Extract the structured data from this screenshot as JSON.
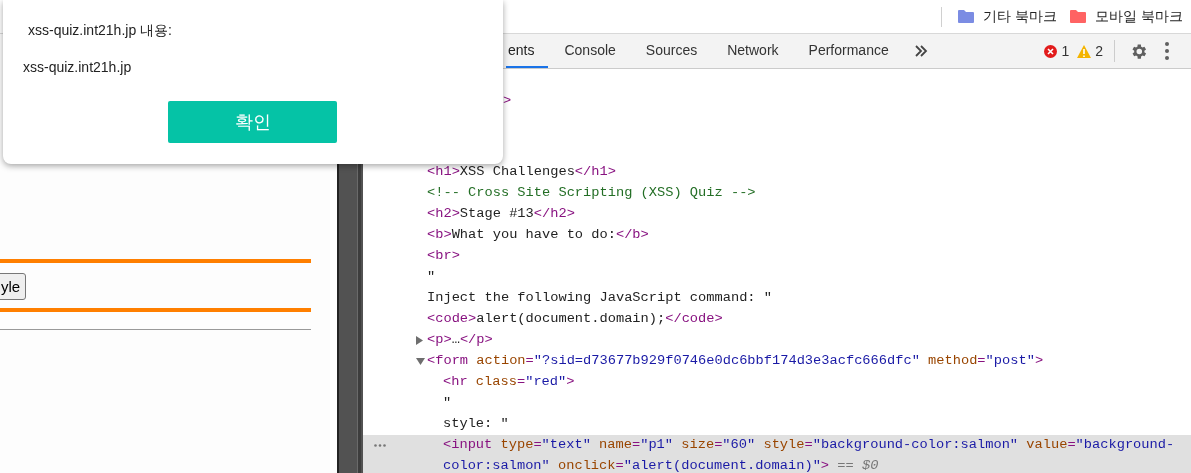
{
  "bookmarks": [
    {
      "label": "기타 북마크",
      "color": "#7b8ce3"
    },
    {
      "label": "모바일 북마크",
      "color": "#ff6363"
    }
  ],
  "page": {
    "button": "yle"
  },
  "dialog": {
    "title": "xss-quiz.int21h.jp 내용:",
    "message": "xss-quiz.int21h.jp",
    "ok": "확인"
  },
  "devtools": {
    "tabs": [
      {
        "label": "ents",
        "selected": true
      },
      {
        "label": "Console",
        "selected": false
      },
      {
        "label": "Sources",
        "selected": false
      },
      {
        "label": "Network",
        "selected": false
      },
      {
        "label": "Performance",
        "selected": false
      }
    ],
    "errors": "1",
    "warnings": "2",
    "elements": [
      {
        "kind": "clipped",
        "selected": false,
        "tokens": [
          {
            "kind": "tag",
            "text": ">"
          }
        ]
      },
      {
        "kind": "node",
        "selected": false,
        "tokens": [
          {
            "kind": "tag",
            "text": "<h1>"
          },
          {
            "kind": "text",
            "text": "XSS Challenges"
          },
          {
            "kind": "tag",
            "text": "</h1>"
          }
        ]
      },
      {
        "kind": "node",
        "selected": false,
        "tokens": [
          {
            "kind": "comment",
            "text": "<!-- Cross Site Scripting (XSS) Quiz -->"
          }
        ]
      },
      {
        "kind": "node",
        "selected": false,
        "tokens": [
          {
            "kind": "tag",
            "text": "<h2>"
          },
          {
            "kind": "text",
            "text": "Stage #13"
          },
          {
            "kind": "tag",
            "text": "</h2>"
          }
        ]
      },
      {
        "kind": "node",
        "selected": false,
        "tokens": [
          {
            "kind": "tag",
            "text": "<b>"
          },
          {
            "kind": "text",
            "text": "What you have to do:"
          },
          {
            "kind": "tag",
            "text": "</b>"
          }
        ]
      },
      {
        "kind": "node",
        "selected": false,
        "tokens": [
          {
            "kind": "tag",
            "text": "<br>"
          }
        ]
      },
      {
        "kind": "node",
        "selected": false,
        "tokens": [
          {
            "kind": "text",
            "text": "\""
          }
        ]
      },
      {
        "kind": "node",
        "selected": false,
        "tokens": [
          {
            "kind": "text",
            "text": "Inject the following JavaScript command: \""
          }
        ]
      },
      {
        "kind": "node",
        "selected": false,
        "tokens": [
          {
            "kind": "tag",
            "text": "<code>"
          },
          {
            "kind": "text",
            "text": "alert(document.domain);"
          },
          {
            "kind": "tag",
            "text": "</code>"
          }
        ]
      },
      {
        "kind": "node",
        "selected": false,
        "expanded": false,
        "tokens": [
          {
            "kind": "tag",
            "text": "<p>"
          },
          {
            "kind": "text",
            "text": "…"
          },
          {
            "kind": "tag",
            "text": "</p>"
          }
        ]
      },
      {
        "kind": "node",
        "selected": false,
        "expanded": true,
        "tokens": [
          {
            "kind": "tag",
            "text": "<form"
          },
          {
            "kind": "attr",
            "text": " action"
          },
          {
            "kind": "tag",
            "text": "="
          },
          {
            "kind": "value",
            "text": "\"?sid=d73677b929f0746e0dc6bbf174d3e3acfc666dfc\""
          },
          {
            "kind": "attr",
            "text": " method"
          },
          {
            "kind": "tag",
            "text": "="
          },
          {
            "kind": "value",
            "text": "\"post\""
          },
          {
            "kind": "tag",
            "text": ">"
          }
        ],
        "children": [
          {
            "kind": "node",
            "selected": false,
            "tokens": [
              {
                "kind": "tag",
                "text": "<hr"
              },
              {
                "kind": "attr",
                "text": " class"
              },
              {
                "kind": "tag",
                "text": "="
              },
              {
                "kind": "value",
                "text": "\"red\""
              },
              {
                "kind": "tag",
                "text": ">"
              }
            ]
          },
          {
            "kind": "node",
            "selected": false,
            "tokens": [
              {
                "kind": "text",
                "text": "\""
              }
            ]
          },
          {
            "kind": "node",
            "selected": false,
            "tokens": [
              {
                "kind": "text",
                "text": "style: \""
              }
            ]
          },
          {
            "kind": "node",
            "selected": true,
            "tokens": [
              {
                "kind": "tag",
                "text": "<input"
              },
              {
                "kind": "attr",
                "text": " type"
              },
              {
                "kind": "tag",
                "text": "="
              },
              {
                "kind": "value",
                "text": "\"text\""
              },
              {
                "kind": "attr",
                "text": " name"
              },
              {
                "kind": "tag",
                "text": "="
              },
              {
                "kind": "value",
                "text": "\"p1\""
              },
              {
                "kind": "attr",
                "text": " size"
              },
              {
                "kind": "tag",
                "text": "="
              },
              {
                "kind": "value",
                "text": "\"60\""
              },
              {
                "kind": "attr",
                "text": " style"
              },
              {
                "kind": "tag",
                "text": "="
              },
              {
                "kind": "value",
                "text": "\"background-color:salmon\""
              },
              {
                "kind": "attr",
                "text": " value"
              },
              {
                "kind": "tag",
                "text": "="
              },
              {
                "kind": "value",
                "text": "\"background-color:salmon\""
              },
              {
                "kind": "attr",
                "text": " onclick"
              },
              {
                "kind": "tag",
                "text": "="
              },
              {
                "kind": "value",
                "text": "\"alert(document.domain)\""
              },
              {
                "kind": "tag",
                "text": ">"
              },
              {
                "kind": "note",
                "text": " == $0"
              }
            ]
          }
        ]
      }
    ]
  }
}
